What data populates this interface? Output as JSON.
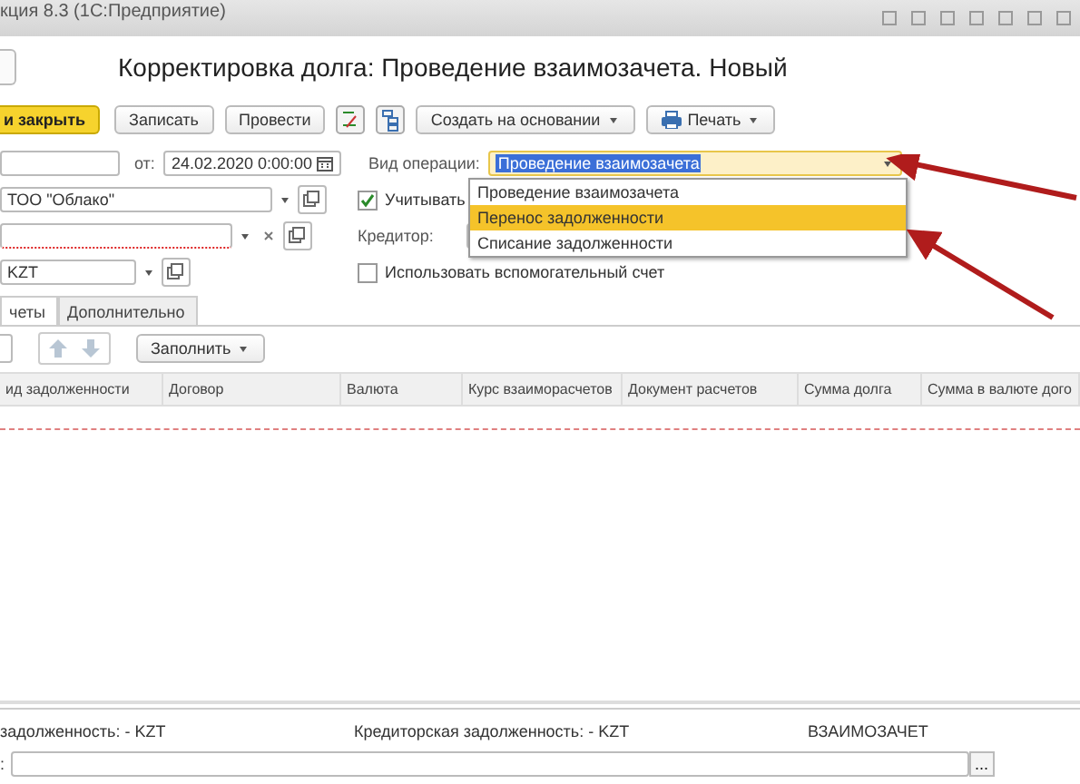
{
  "window": {
    "title": "кция 8.3 (1С:Предприятие)"
  },
  "document": {
    "title": "Корректировка долга: Проведение взаимозачета. Новый"
  },
  "toolbar": {
    "buttons": [
      {
        "label": "и закрыть",
        "kind": "primary"
      },
      {
        "label": "Записать",
        "kind": "plain"
      },
      {
        "label": "Провести",
        "kind": "plain"
      }
    ],
    "menus": [
      {
        "label": "Создать на основании"
      },
      {
        "label": "Печать",
        "kind": "print"
      }
    ]
  },
  "header": {
    "date_label": "от:",
    "date": "24.02.2020  0:00:00",
    "operation_label": "Вид операции:",
    "operation": "Проведение взаимозачета",
    "organization": "ТОО \"Облако\"",
    "counterparty_required": true,
    "currency": "KZT",
    "creditor_label": "Кредитор:",
    "checkboxes": [
      {
        "label": "Учитывать",
        "checked": true
      },
      {
        "label": "Использовать вспомогательный счет",
        "checked": false
      }
    ]
  },
  "operation_list": [
    {
      "label": "Проведение взаимозачета",
      "selected": false
    },
    {
      "label": "Перенос задолженности",
      "selected": true
    },
    {
      "label": "Списание задолженности",
      "selected": false
    }
  ],
  "tabs": [
    {
      "label": "четы",
      "selected": true
    },
    {
      "label": "Дополнительно",
      "selected": false
    }
  ],
  "table": {
    "fill_button": "Заполнить",
    "columns": [
      "ид задолженности",
      "Договор",
      "Валюта",
      "Курс взаиморасчетов",
      "Документ расчетов",
      "Сумма долга",
      "Сумма в валюте дого"
    ]
  },
  "footer": {
    "debit_total": "задолженность: - KZT",
    "credit_total": "Кредиторская задолженность: - KZT",
    "operation": "ВЗАИМОЗАЧЕТ",
    "comment_label": ":",
    "select_button": "..."
  }
}
